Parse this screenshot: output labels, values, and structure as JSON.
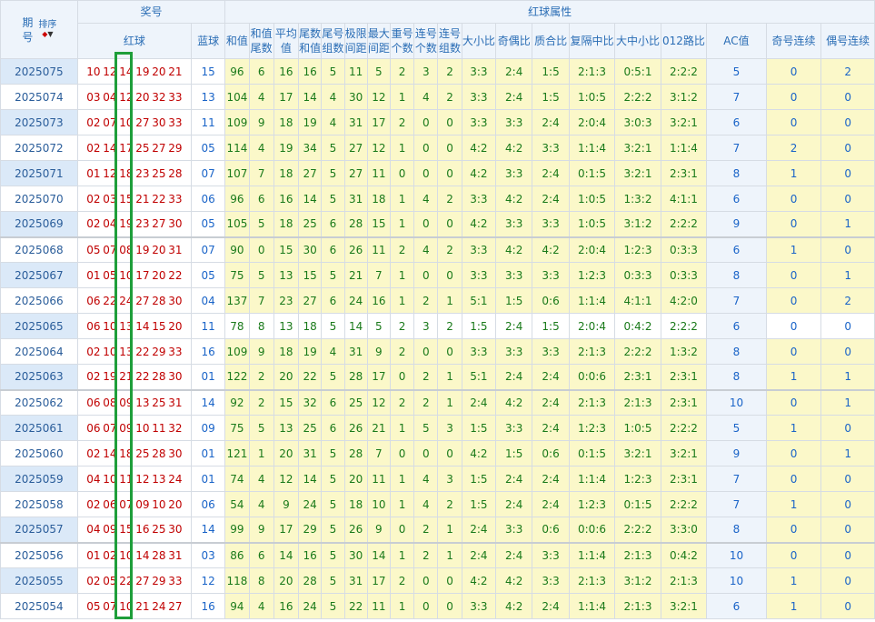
{
  "header": {
    "period_label": "期号",
    "sort_label": "排序",
    "draw_group": "奖号",
    "attr_group": "红球属性",
    "red_label": "红球",
    "blue_label": "蓝球",
    "cols": [
      "和值",
      "和值尾数",
      "平均值",
      "尾数和值",
      "尾号组数",
      "极限间距",
      "最大间距",
      "重号个数",
      "连号个数",
      "连号组数",
      "大小比",
      "奇偶比",
      "质合比",
      "复隔中比",
      "大中小比",
      "012路比",
      "AC值",
      "奇号连续",
      "偶号连续"
    ]
  },
  "rows": [
    {
      "period": "2025075",
      "reds": [
        "10",
        "12",
        "14",
        "19",
        "20",
        "21"
      ],
      "blue": "15",
      "vals": [
        "96",
        "6",
        "16",
        "16",
        "5",
        "11",
        "5",
        "2",
        "3",
        "2",
        "3:3",
        "2:4",
        "1:5",
        "2:1:3",
        "0:5:1",
        "2:2:2",
        "5",
        "0",
        "2"
      ]
    },
    {
      "period": "2025074",
      "reds": [
        "03",
        "04",
        "12",
        "20",
        "32",
        "33"
      ],
      "blue": "13",
      "vals": [
        "104",
        "4",
        "17",
        "14",
        "4",
        "30",
        "12",
        "1",
        "4",
        "2",
        "3:3",
        "2:4",
        "1:5",
        "1:0:5",
        "2:2:2",
        "3:1:2",
        "7",
        "0",
        "0"
      ]
    },
    {
      "period": "2025073",
      "reds": [
        "02",
        "07",
        "10",
        "27",
        "30",
        "33"
      ],
      "blue": "11",
      "vals": [
        "109",
        "9",
        "18",
        "19",
        "4",
        "31",
        "17",
        "2",
        "0",
        "0",
        "3:3",
        "3:3",
        "2:4",
        "2:0:4",
        "3:0:3",
        "3:2:1",
        "6",
        "0",
        "0"
      ]
    },
    {
      "period": "2025072",
      "reds": [
        "02",
        "14",
        "17",
        "25",
        "27",
        "29"
      ],
      "blue": "05",
      "vals": [
        "114",
        "4",
        "19",
        "34",
        "5",
        "27",
        "12",
        "1",
        "0",
        "0",
        "4:2",
        "4:2",
        "3:3",
        "1:1:4",
        "3:2:1",
        "1:1:4",
        "7",
        "2",
        "0"
      ]
    },
    {
      "period": "2025071",
      "reds": [
        "01",
        "12",
        "18",
        "23",
        "25",
        "28"
      ],
      "blue": "07",
      "vals": [
        "107",
        "7",
        "18",
        "27",
        "5",
        "27",
        "11",
        "0",
        "0",
        "0",
        "4:2",
        "3:3",
        "2:4",
        "0:1:5",
        "3:2:1",
        "2:3:1",
        "8",
        "1",
        "0"
      ]
    },
    {
      "period": "2025070",
      "reds": [
        "02",
        "03",
        "15",
        "21",
        "22",
        "33"
      ],
      "blue": "06",
      "vals": [
        "96",
        "6",
        "16",
        "14",
        "5",
        "31",
        "18",
        "1",
        "4",
        "2",
        "3:3",
        "4:2",
        "2:4",
        "1:0:5",
        "1:3:2",
        "4:1:1",
        "6",
        "0",
        "0"
      ]
    },
    {
      "period": "2025069",
      "reds": [
        "02",
        "04",
        "19",
        "23",
        "27",
        "30"
      ],
      "blue": "05",
      "vals": [
        "105",
        "5",
        "18",
        "25",
        "6",
        "28",
        "15",
        "1",
        "0",
        "0",
        "4:2",
        "3:3",
        "3:3",
        "1:0:5",
        "3:1:2",
        "2:2:2",
        "9",
        "0",
        "1"
      ]
    },
    {
      "period": "2025068",
      "reds": [
        "05",
        "07",
        "08",
        "19",
        "20",
        "31"
      ],
      "blue": "07",
      "vals": [
        "90",
        "0",
        "15",
        "30",
        "6",
        "26",
        "11",
        "2",
        "4",
        "2",
        "3:3",
        "4:2",
        "4:2",
        "2:0:4",
        "1:2:3",
        "0:3:3",
        "6",
        "1",
        "0"
      ]
    },
    {
      "period": "2025067",
      "reds": [
        "01",
        "05",
        "10",
        "17",
        "20",
        "22"
      ],
      "blue": "05",
      "vals": [
        "75",
        "5",
        "13",
        "15",
        "5",
        "21",
        "7",
        "1",
        "0",
        "0",
        "3:3",
        "3:3",
        "3:3",
        "1:2:3",
        "0:3:3",
        "0:3:3",
        "8",
        "0",
        "1"
      ]
    },
    {
      "period": "2025066",
      "reds": [
        "06",
        "22",
        "24",
        "27",
        "28",
        "30"
      ],
      "blue": "04",
      "vals": [
        "137",
        "7",
        "23",
        "27",
        "6",
        "24",
        "16",
        "1",
        "2",
        "1",
        "5:1",
        "1:5",
        "0:6",
        "1:1:4",
        "4:1:1",
        "4:2:0",
        "7",
        "0",
        "2"
      ]
    },
    {
      "period": "2025065",
      "reds": [
        "06",
        "10",
        "13",
        "14",
        "15",
        "20"
      ],
      "blue": "11",
      "vals": [
        "78",
        "8",
        "13",
        "18",
        "5",
        "14",
        "5",
        "2",
        "3",
        "2",
        "1:5",
        "2:4",
        "1:5",
        "2:0:4",
        "0:4:2",
        "2:2:2",
        "6",
        "0",
        "0"
      ]
    },
    {
      "period": "2025064",
      "reds": [
        "02",
        "10",
        "13",
        "22",
        "29",
        "33"
      ],
      "blue": "16",
      "vals": [
        "109",
        "9",
        "18",
        "19",
        "4",
        "31",
        "9",
        "2",
        "0",
        "0",
        "3:3",
        "3:3",
        "3:3",
        "2:1:3",
        "2:2:2",
        "1:3:2",
        "8",
        "0",
        "0"
      ]
    },
    {
      "period": "2025063",
      "reds": [
        "02",
        "19",
        "21",
        "22",
        "28",
        "30"
      ],
      "blue": "01",
      "vals": [
        "122",
        "2",
        "20",
        "22",
        "5",
        "28",
        "17",
        "0",
        "2",
        "1",
        "5:1",
        "2:4",
        "2:4",
        "0:0:6",
        "2:3:1",
        "2:3:1",
        "8",
        "1",
        "1"
      ]
    },
    {
      "period": "2025062",
      "reds": [
        "06",
        "08",
        "09",
        "13",
        "25",
        "31"
      ],
      "blue": "14",
      "vals": [
        "92",
        "2",
        "15",
        "32",
        "6",
        "25",
        "12",
        "2",
        "2",
        "1",
        "2:4",
        "4:2",
        "2:4",
        "2:1:3",
        "2:1:3",
        "2:3:1",
        "10",
        "0",
        "1"
      ]
    },
    {
      "period": "2025061",
      "reds": [
        "06",
        "07",
        "09",
        "10",
        "11",
        "32"
      ],
      "blue": "09",
      "vals": [
        "75",
        "5",
        "13",
        "25",
        "6",
        "26",
        "21",
        "1",
        "5",
        "3",
        "1:5",
        "3:3",
        "2:4",
        "1:2:3",
        "1:0:5",
        "2:2:2",
        "5",
        "1",
        "0"
      ]
    },
    {
      "period": "2025060",
      "reds": [
        "02",
        "14",
        "18",
        "25",
        "28",
        "30"
      ],
      "blue": "01",
      "vals": [
        "121",
        "1",
        "20",
        "31",
        "5",
        "28",
        "7",
        "0",
        "0",
        "0",
        "4:2",
        "1:5",
        "0:6",
        "0:1:5",
        "3:2:1",
        "3:2:1",
        "9",
        "0",
        "1"
      ]
    },
    {
      "period": "2025059",
      "reds": [
        "04",
        "10",
        "11",
        "12",
        "13",
        "24"
      ],
      "blue": "01",
      "vals": [
        "74",
        "4",
        "12",
        "14",
        "5",
        "20",
        "11",
        "1",
        "4",
        "3",
        "1:5",
        "2:4",
        "2:4",
        "1:1:4",
        "1:2:3",
        "2:3:1",
        "7",
        "0",
        "0"
      ]
    },
    {
      "period": "2025058",
      "reds": [
        "02",
        "06",
        "07",
        "09",
        "10",
        "20"
      ],
      "blue": "06",
      "vals": [
        "54",
        "4",
        "9",
        "24",
        "5",
        "18",
        "10",
        "1",
        "4",
        "2",
        "1:5",
        "2:4",
        "2:4",
        "1:2:3",
        "0:1:5",
        "2:2:2",
        "7",
        "1",
        "0"
      ]
    },
    {
      "period": "2025057",
      "reds": [
        "04",
        "09",
        "15",
        "16",
        "25",
        "30"
      ],
      "blue": "14",
      "vals": [
        "99",
        "9",
        "17",
        "29",
        "5",
        "26",
        "9",
        "0",
        "2",
        "1",
        "2:4",
        "3:3",
        "0:6",
        "0:0:6",
        "2:2:2",
        "3:3:0",
        "8",
        "0",
        "0"
      ]
    },
    {
      "period": "2025056",
      "reds": [
        "01",
        "02",
        "10",
        "14",
        "28",
        "31"
      ],
      "blue": "03",
      "vals": [
        "86",
        "6",
        "14",
        "16",
        "5",
        "30",
        "14",
        "1",
        "2",
        "1",
        "2:4",
        "2:4",
        "3:3",
        "1:1:4",
        "2:1:3",
        "0:4:2",
        "10",
        "0",
        "0"
      ]
    },
    {
      "period": "2025055",
      "reds": [
        "02",
        "05",
        "22",
        "27",
        "29",
        "33"
      ],
      "blue": "12",
      "vals": [
        "118",
        "8",
        "20",
        "28",
        "5",
        "31",
        "17",
        "2",
        "0",
        "0",
        "4:2",
        "4:2",
        "3:3",
        "2:1:3",
        "3:1:2",
        "2:1:3",
        "10",
        "1",
        "0"
      ]
    },
    {
      "period": "2025054",
      "reds": [
        "05",
        "07",
        "10",
        "21",
        "24",
        "27"
      ],
      "blue": "16",
      "vals": [
        "94",
        "4",
        "16",
        "24",
        "5",
        "22",
        "11",
        "1",
        "0",
        "0",
        "3:3",
        "4:2",
        "2:4",
        "1:1:4",
        "2:1:3",
        "3:2:1",
        "6",
        "1",
        "0"
      ]
    }
  ],
  "colors": {
    "red": "#c00000",
    "blue": "#1a64c8",
    "attr_bg": "#fbf8c9",
    "header_bg": "#eef4fb",
    "highlight": "#1e9e3a"
  }
}
